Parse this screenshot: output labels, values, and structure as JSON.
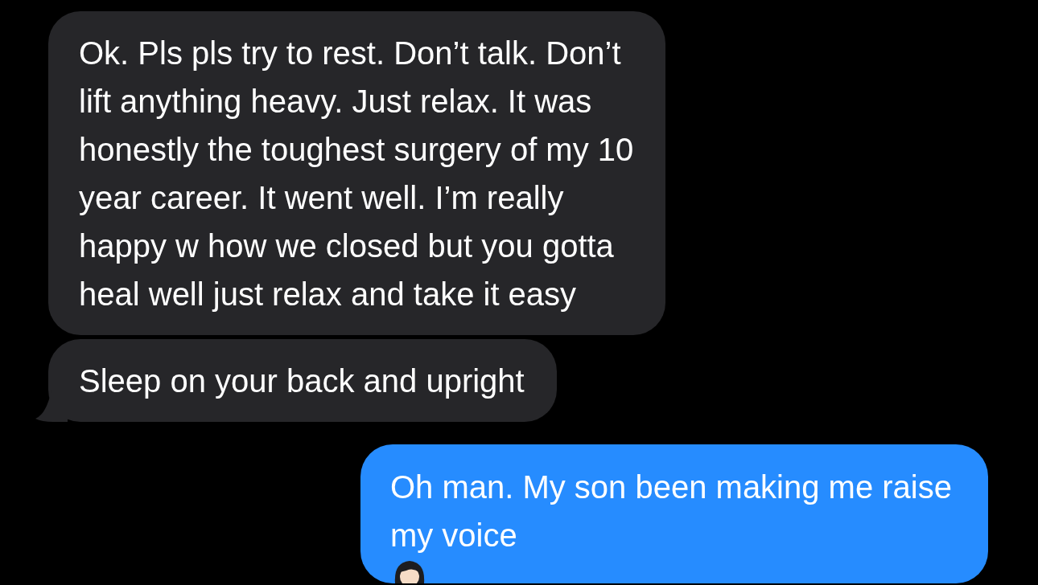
{
  "messages": [
    {
      "kind": "incoming",
      "tail": false,
      "lines": [
        "Ok. Pls pls try to rest. Don’t talk. Don’t",
        "lift anything heavy. Just relax. It was",
        "honestly the toughest surgery of my 10",
        "year career. It went well. I’m really",
        "happy w how we closed but you gotta",
        "heal well just relax and take it easy"
      ]
    },
    {
      "kind": "incoming",
      "tail": true,
      "lines": [
        "Sleep on your back and upright"
      ]
    },
    {
      "kind": "outgoing",
      "tail": false,
      "emoji_icon": true,
      "lines": [
        "Oh man. My son been making me raise",
        "my voice"
      ]
    }
  ]
}
